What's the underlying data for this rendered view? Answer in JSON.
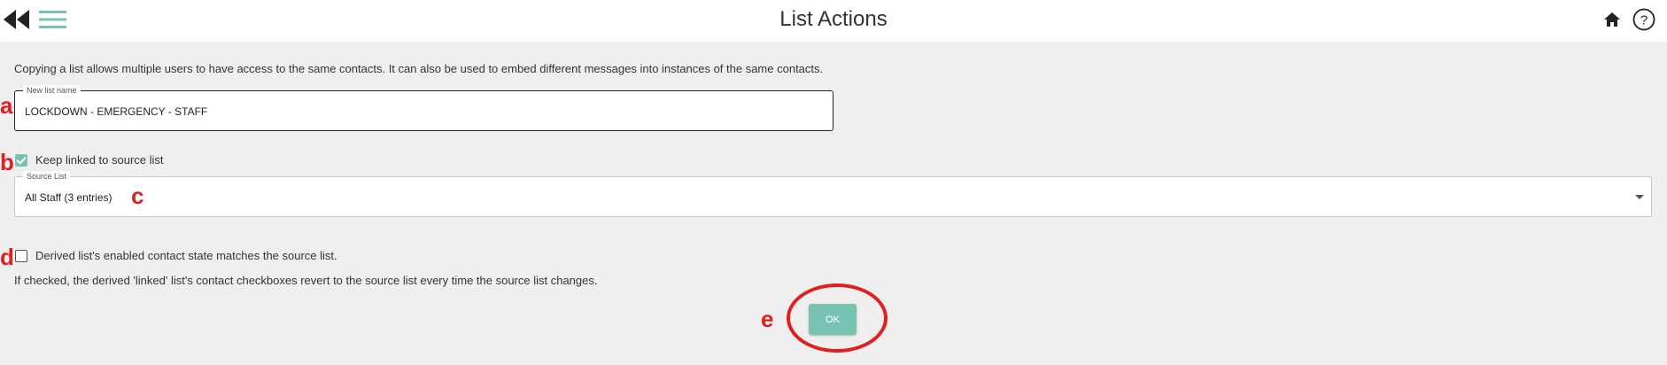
{
  "header": {
    "title": "List Actions",
    "icons": [
      "rewind-icon",
      "menu-icon",
      "home-icon",
      "help-icon"
    ]
  },
  "intro_text": "Copying a list allows multiple users to have access to the same contacts. It can also be used to embed different messages into instances of the same contacts.",
  "new_list": {
    "legend": "New list name",
    "value": "LOCKDOWN - EMERGENCY - STAFF"
  },
  "keep_linked": {
    "label": "Keep linked to source list",
    "checked": true
  },
  "source_list": {
    "legend": "Source List",
    "selected": "All Staff (3 entries)"
  },
  "derived_state": {
    "label": "Derived list's enabled contact state matches the source list.",
    "checked": false
  },
  "note_text": "If checked, the derived 'linked' list's contact checkboxes revert to the source list every time the source list changes.",
  "ok_label": "OK",
  "annotations": {
    "a": "a",
    "b": "b",
    "c": "c",
    "d": "d",
    "e": "e"
  },
  "colors": {
    "accent": "#78c2b1",
    "annotation": "#e02020",
    "background": "#efefef"
  }
}
